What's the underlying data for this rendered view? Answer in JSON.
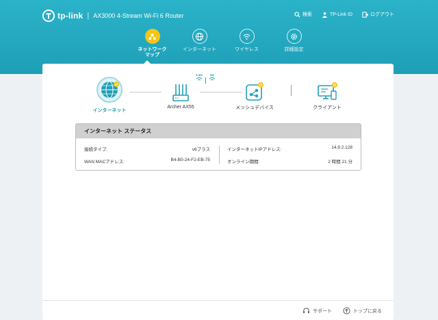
{
  "header": {
    "brand": "tp-link",
    "separator": "|",
    "model": "AX3000 4-Stream Wi-Fi 6 Router",
    "links": [
      {
        "label": "検索",
        "icon": "search-icon"
      },
      {
        "label": "TP-Link ID",
        "icon": "user-icon"
      },
      {
        "label": "ログアウト",
        "icon": "logout-icon"
      }
    ]
  },
  "nav": [
    {
      "label": "ネットワーク\nマップ",
      "icon": "network-map-icon",
      "active": true
    },
    {
      "label": "インターネット",
      "icon": "globe-icon",
      "active": false
    },
    {
      "label": "ワイヤレス",
      "icon": "wifi-icon",
      "active": false
    },
    {
      "label": "詳細設定",
      "icon": "gear-icon",
      "active": false
    }
  ],
  "topology": {
    "internet": "インターネット",
    "router": "Archer AX55",
    "mesh": "メッシュデバイス",
    "client": "クライアント",
    "band_24": "2.4G",
    "band_5": "5G"
  },
  "status": {
    "title": "インターネット ステータス",
    "connection_type_label": "接続タイプ:",
    "connection_type_value": "v6プラス",
    "ip_label": "インターネットIPアドレス:",
    "ip_value": "14.9.2.128",
    "mac_label": "WAN MACアドレス:",
    "mac_value": "B4-B0-24-F2-EB-75",
    "online_label": "オンライン期間:",
    "online_value": "2 時間 21 分"
  },
  "footer": {
    "support": "サポート",
    "back_to_top": "トップに戻る"
  },
  "colors": {
    "header_bg": "#1e9fb7",
    "accent": "#f5c518",
    "active_text": "#1e9fb7"
  }
}
